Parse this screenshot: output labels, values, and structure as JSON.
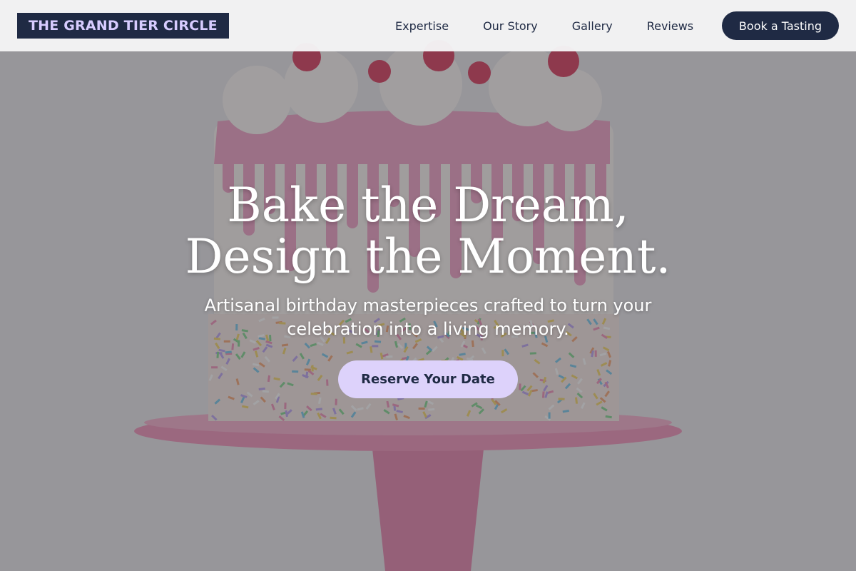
{
  "brand": {
    "name": "THE GRAND TIER CIRCLE"
  },
  "nav": {
    "links": [
      {
        "label": "Expertise"
      },
      {
        "label": "Our Story"
      },
      {
        "label": "Gallery"
      },
      {
        "label": "Reviews"
      }
    ],
    "cta_label": "Book a Tasting"
  },
  "hero": {
    "headline_line1": "Bake the Dream,",
    "headline_line2": "Design the Moment.",
    "subheadline": "Artisanal birthday masterpieces crafted to turn your celebration into a living memory.",
    "cta_label": "Reserve Your Date",
    "image": "pink-drip-birthday-cake-on-stand"
  },
  "colors": {
    "navy": "#1f2a44",
    "lavender": "#ddd2fb",
    "cake_pink": "#e98cb6",
    "background_overlay": "#46464a"
  }
}
